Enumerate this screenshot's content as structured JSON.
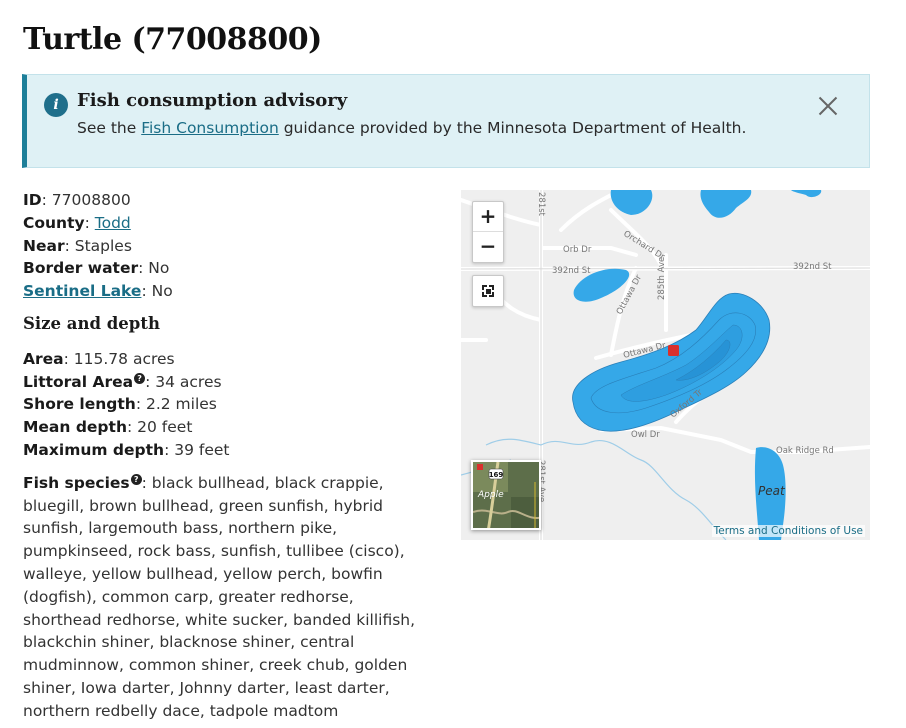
{
  "page": {
    "title": "Turtle (77008800)"
  },
  "advisory": {
    "title": "Fish consumption advisory",
    "text_before": "See the ",
    "link_text": "Fish Consumption",
    "text_after": " guidance provided by the Minnesota Department of Health."
  },
  "details": {
    "id_label": "ID",
    "id_value": "77008800",
    "county_label": "County",
    "county_value": "Todd",
    "near_label": "Near",
    "near_value": "Staples",
    "border_label": "Border water",
    "border_value": "No",
    "sentinel_label": "Sentinel Lake",
    "sentinel_value": "No"
  },
  "size_depth": {
    "heading": "Size and depth",
    "area_label": "Area",
    "area_value": "115.78 acres",
    "littoral_label": "Littoral Area",
    "littoral_value": "34 acres",
    "shore_label": "Shore length",
    "shore_value": "2.2 miles",
    "mean_label": "Mean depth",
    "mean_value": "20 feet",
    "max_label": "Maximum depth",
    "max_value": "39 feet"
  },
  "fish": {
    "label": "Fish species",
    "value": "black bullhead, black crappie, bluegill, brown bullhead, green sunfish, hybrid sunfish, largemouth bass, northern pike, pumpkinseed, rock bass, sunfish, tullibee (cisco), walleye, yellow bullhead, yellow perch, bowfin (dogfish), common carp, greater redhorse, shorthead redhorse, white sucker, banded killifish, blackchin shiner, blacknose shiner, central mudminnow, common shiner, creek chub, golden shiner, Iowa darter, Johnny darter, least darter, northern redbelly dace, tadpole madtom"
  },
  "map": {
    "zoom_in": "+",
    "zoom_out": "−",
    "roads": {
      "orb": "Orb Dr",
      "orchard": "Orchard Dr",
      "r392_left": "392nd St",
      "r392_right": "392nd St",
      "ottawa1": "Ottawa Dr",
      "ottawa2": "Ottawa Dr",
      "r285": "285th Ave",
      "r281": "281st Ave",
      "r281_top": "281st",
      "owl": "Owl Dr",
      "oxford": "Oxford Tr",
      "oakridge": "Oak Ridge Rd"
    },
    "lake_label": "Peat",
    "minimap_shield": "169",
    "minimap_label": "Apple",
    "terms": "Terms and Conditions of Use",
    "colors": {
      "water": "#35a8e8",
      "water_deep": "#2793d6",
      "land": "#efefef",
      "road": "#ffffff"
    }
  }
}
